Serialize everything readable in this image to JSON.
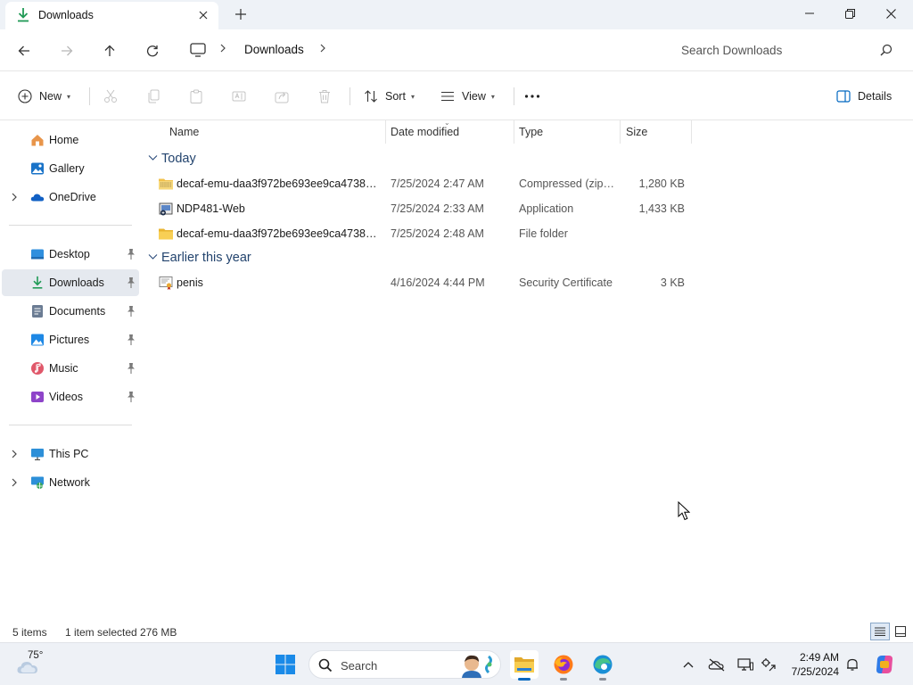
{
  "window": {
    "tab_title": "Downloads",
    "new_tab_glyph": "+",
    "close_tab_glyph": "✕"
  },
  "address": {
    "breadcrumb": [
      "Downloads"
    ],
    "search_placeholder": "Search Downloads"
  },
  "commands": {
    "new_label": "New",
    "sort_label": "Sort",
    "view_label": "View",
    "more_label": "···",
    "details_label": "Details",
    "disabled_icons": [
      "cut-icon",
      "copy-icon",
      "paste-icon",
      "rename-icon",
      "share-icon",
      "delete-icon"
    ]
  },
  "sidebar": {
    "items": [
      {
        "label": "Home",
        "icon": "home-icon"
      },
      {
        "label": "Gallery",
        "icon": "gallery-icon"
      },
      {
        "label": "OneDrive",
        "icon": "onedrive-icon",
        "expandable": true
      },
      {
        "label": "Desktop",
        "icon": "desktop-icon",
        "pinned": true
      },
      {
        "label": "Downloads",
        "icon": "downloads-icon",
        "pinned": true,
        "selected": true
      },
      {
        "label": "Documents",
        "icon": "documents-icon",
        "pinned": true
      },
      {
        "label": "Pictures",
        "icon": "pictures-icon",
        "pinned": true
      },
      {
        "label": "Music",
        "icon": "music-icon",
        "pinned": true
      },
      {
        "label": "Videos",
        "icon": "videos-icon",
        "pinned": true
      },
      {
        "label": "This PC",
        "icon": "this-pc-icon",
        "expandable": true
      },
      {
        "label": "Network",
        "icon": "network-icon",
        "expandable": true
      }
    ]
  },
  "filelist": {
    "columns": [
      "Name",
      "Date modified",
      "Type",
      "Size"
    ],
    "sorted_by": "Date modified",
    "groups": [
      {
        "title": "Today",
        "rows": [
          {
            "name": "decaf-emu-daa3f972be693ee9ca4738c20...",
            "date": "7/25/2024 2:47 AM",
            "type": "Compressed (zipp...",
            "size": "1,280 KB",
            "icon": "zip-folder-icon"
          },
          {
            "name": "NDP481-Web",
            "date": "7/25/2024 2:33 AM",
            "type": "Application",
            "size": "1,433 KB",
            "icon": "installer-icon"
          },
          {
            "name": "decaf-emu-daa3f972be693ee9ca4738c20...",
            "date": "7/25/2024 2:48 AM",
            "type": "File folder",
            "size": "",
            "icon": "folder-icon"
          }
        ]
      },
      {
        "title": "Earlier this year",
        "rows": [
          {
            "name": "penis",
            "date": "4/16/2024 4:44 PM",
            "type": "Security Certificate",
            "size": "3 KB",
            "icon": "certificate-icon"
          }
        ]
      }
    ]
  },
  "status": {
    "item_count": "5 items",
    "selection": "1 item selected",
    "selection_size": "276 MB"
  },
  "taskbar": {
    "weather_temp": "75°",
    "search_label": "Search",
    "clock_time": "2:49 AM",
    "clock_date": "7/25/2024",
    "pinned_apps": [
      "file-explorer-icon",
      "firefox-icon",
      "edge-icon"
    ],
    "accent": "#0067c0"
  }
}
